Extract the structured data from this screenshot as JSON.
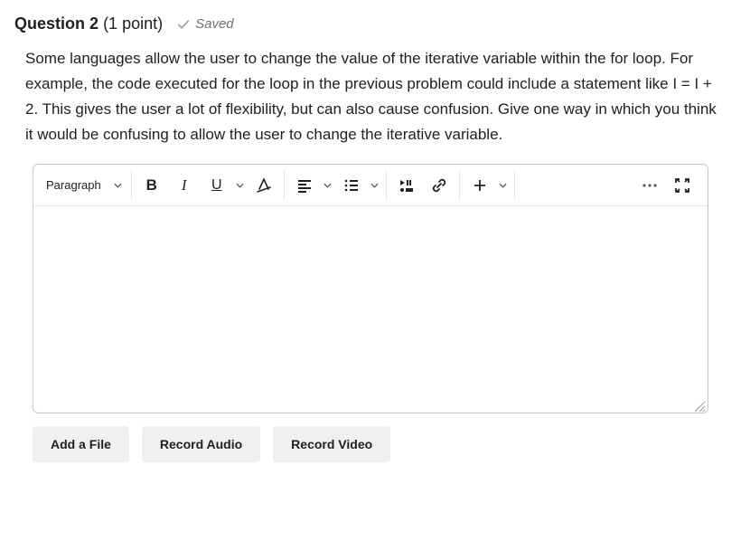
{
  "question": {
    "label_prefix": "Question",
    "number": "2",
    "points_text": "(1 point)",
    "saved_label": "Saved",
    "prompt": "Some languages allow the user to change the value of the iterative variable within the for loop. For example, the code executed for the loop in the previous problem could include a statement like I = I + 2. This gives the user a lot of flexibility, but can also cause confusion. Give one way in which you think it would be confusing to allow the user to change the iterative variable."
  },
  "toolbar": {
    "block_format": "Paragraph"
  },
  "attachments": {
    "add_file": "Add a File",
    "record_audio": "Record Audio",
    "record_video": "Record Video"
  }
}
